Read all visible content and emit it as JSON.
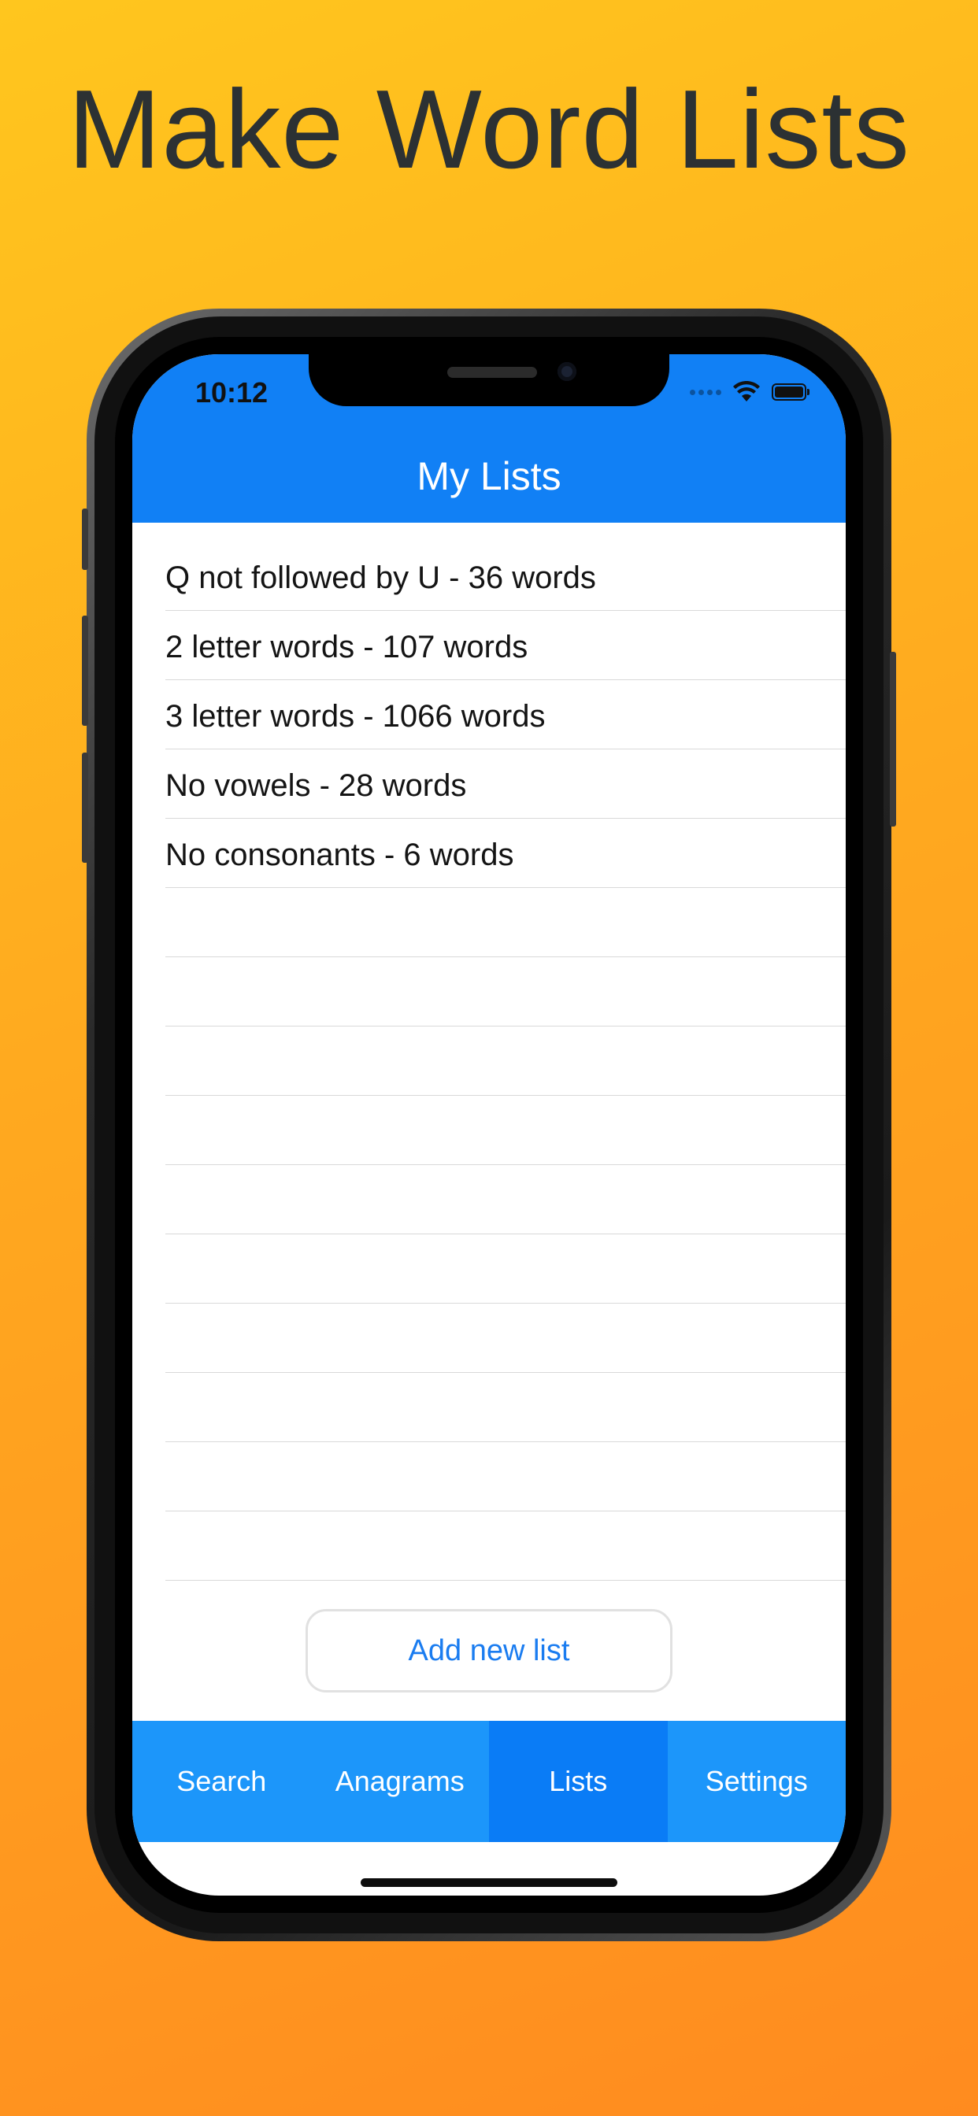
{
  "headline": "Make Word Lists",
  "status_bar": {
    "time": "10:12"
  },
  "nav": {
    "title": "My Lists"
  },
  "lists": [
    {
      "label": "Q not followed by U - 36 words"
    },
    {
      "label": "2 letter words - 107 words"
    },
    {
      "label": "3 letter words - 1066 words"
    },
    {
      "label": "No vowels - 28 words"
    },
    {
      "label": "No consonants - 6 words"
    },
    {
      "label": ""
    },
    {
      "label": ""
    },
    {
      "label": ""
    },
    {
      "label": ""
    },
    {
      "label": ""
    },
    {
      "label": ""
    },
    {
      "label": ""
    },
    {
      "label": ""
    },
    {
      "label": ""
    },
    {
      "label": ""
    }
  ],
  "add_button": {
    "label": "Add new list"
  },
  "tabs": [
    {
      "label": "Search",
      "active": false
    },
    {
      "label": "Anagrams",
      "active": false
    },
    {
      "label": "Lists",
      "active": true
    },
    {
      "label": "Settings",
      "active": false
    }
  ],
  "colors": {
    "accent_blue": "#1180F5",
    "tab_blue": "#1C96FA",
    "tab_active": "#0A7CF6",
    "background_top": "#FFC61E",
    "background_bottom": "#FF8B1F"
  }
}
